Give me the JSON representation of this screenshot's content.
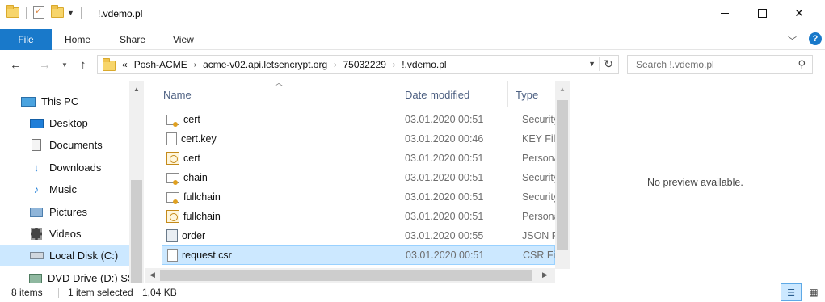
{
  "window": {
    "title": "!.vdemo.pl",
    "controls": {
      "minimize": "",
      "maximize": "",
      "close": "✕"
    }
  },
  "ribbon": {
    "tabs": [
      "File",
      "Home",
      "Share",
      "View"
    ],
    "help": "?"
  },
  "address": {
    "prefix": "«",
    "crumbs": [
      "Posh-ACME",
      "acme-v02.api.letsencrypt.org",
      "75032229",
      "!.vdemo.pl"
    ],
    "separator": "›"
  },
  "search": {
    "placeholder": "Search !.vdemo.pl"
  },
  "navpane": {
    "items": [
      {
        "label": "This PC",
        "icon": "pc-icon"
      },
      {
        "label": "Desktop",
        "icon": "desktop-icon"
      },
      {
        "label": "Documents",
        "icon": "documents-icon"
      },
      {
        "label": "Downloads",
        "icon": "downloads-icon"
      },
      {
        "label": "Music",
        "icon": "music-icon"
      },
      {
        "label": "Pictures",
        "icon": "pictures-icon"
      },
      {
        "label": "Videos",
        "icon": "videos-icon"
      },
      {
        "label": "Local Disk (C:)",
        "icon": "disk-icon",
        "selected": true
      },
      {
        "label": "DVD Drive (D:) SS",
        "icon": "dvd-icon"
      }
    ]
  },
  "filelist": {
    "columns": [
      "Name",
      "Date modified",
      "Type"
    ],
    "rows": [
      {
        "name": "cert",
        "date": "03.01.2020 00:51",
        "type": "Security",
        "icon": "certificate-icon"
      },
      {
        "name": "cert.key",
        "date": "03.01.2020 00:46",
        "type": "KEY File",
        "icon": "blank-file-icon"
      },
      {
        "name": "cert",
        "date": "03.01.2020 00:51",
        "type": "Persona",
        "icon": "personal-info-exchange-icon"
      },
      {
        "name": "chain",
        "date": "03.01.2020 00:51",
        "type": "Security",
        "icon": "certificate-icon"
      },
      {
        "name": "fullchain",
        "date": "03.01.2020 00:51",
        "type": "Security",
        "icon": "certificate-icon"
      },
      {
        "name": "fullchain",
        "date": "03.01.2020 00:51",
        "type": "Persona",
        "icon": "personal-info-exchange-icon"
      },
      {
        "name": "order",
        "date": "03.01.2020 00:55",
        "type": "JSON Fi",
        "icon": "json-file-icon"
      },
      {
        "name": "request.csr",
        "date": "03.01.2020 00:51",
        "type": "CSR File",
        "icon": "blank-file-icon",
        "selected": true
      }
    ]
  },
  "preview": {
    "message": "No preview available."
  },
  "status": {
    "item_count": "8 items",
    "selection": "1 item selected",
    "size": "1,04 KB"
  },
  "colors": {
    "accent": "#1979ca",
    "selection": "#cce8ff",
    "selection_border": "#99d1ff"
  }
}
